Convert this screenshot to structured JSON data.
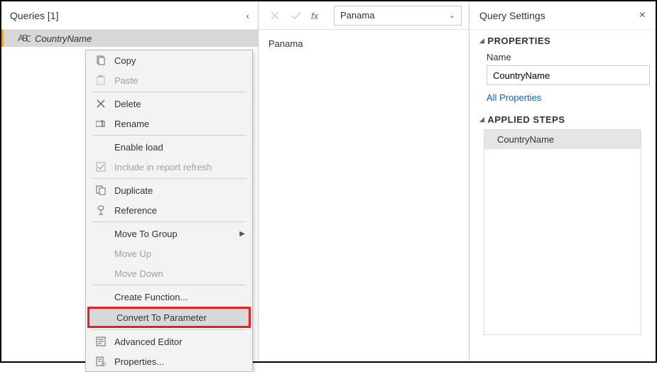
{
  "queries": {
    "header": "Queries [1]",
    "selected_query": "CountryName"
  },
  "context_menu": {
    "copy": "Copy",
    "paste": "Paste",
    "delete": "Delete",
    "rename": "Rename",
    "enable_load": "Enable load",
    "include_refresh": "Include in report refresh",
    "duplicate": "Duplicate",
    "reference": "Reference",
    "move_to_group": "Move To Group",
    "move_up": "Move Up",
    "move_down": "Move Down",
    "create_function": "Create Function...",
    "convert_to_parameter": "Convert To Parameter",
    "advanced_editor": "Advanced Editor",
    "properties": "Properties..."
  },
  "formula_bar": {
    "value": "Panama"
  },
  "preview": {
    "value": "Panama"
  },
  "settings": {
    "title": "Query Settings",
    "properties_header": "PROPERTIES",
    "name_label": "Name",
    "name_value": "CountryName",
    "all_properties": "All Properties",
    "applied_steps_header": "APPLIED STEPS",
    "step1": "CountryName"
  }
}
